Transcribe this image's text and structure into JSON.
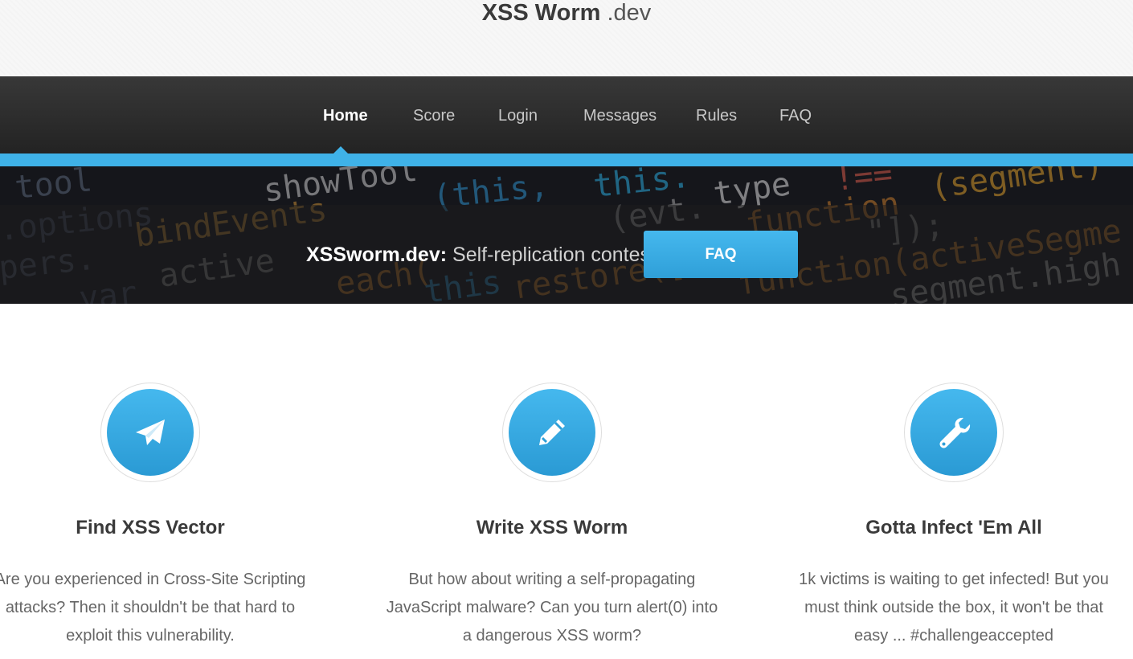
{
  "brand": {
    "name": "XSS Worm",
    "suffix": ".dev"
  },
  "nav": {
    "items": [
      {
        "label": "Home",
        "active": true
      },
      {
        "label": "Score"
      },
      {
        "label": "Login"
      },
      {
        "label": "Messages"
      },
      {
        "label": "Rules"
      },
      {
        "label": "FAQ"
      }
    ]
  },
  "hero": {
    "title": "XSSworm.dev:",
    "subtitle": "Self-replication contest",
    "button_label": "FAQ"
  },
  "features": [
    {
      "icon": "paper-plane-icon",
      "title": "Find XSS Vector",
      "text_lines": [
        "Are you experienced in Cross-Site Scripting",
        "attacks? Then it shouldn't be that hard to",
        "exploit this vulnerability."
      ]
    },
    {
      "icon": "pencil-icon",
      "title": "Write XSS Worm",
      "text_lines": [
        "But how about writing a self-propagating",
        "JavaScript malware? Can you turn alert(0) into",
        "a dangerous XSS worm?"
      ]
    },
    {
      "icon": "wrench-icon",
      "title": "Gotta Infect 'Em All",
      "text_lines": [
        "1k victims is waiting to get infected! But you",
        "must think outside the box, it won't be that",
        "easy ... #challengeaccepted"
      ]
    }
  ],
  "colors": {
    "accent": "#3fb2e8",
    "nav_bg": "#2a2a2a",
    "hero_bg": "#15161b"
  }
}
